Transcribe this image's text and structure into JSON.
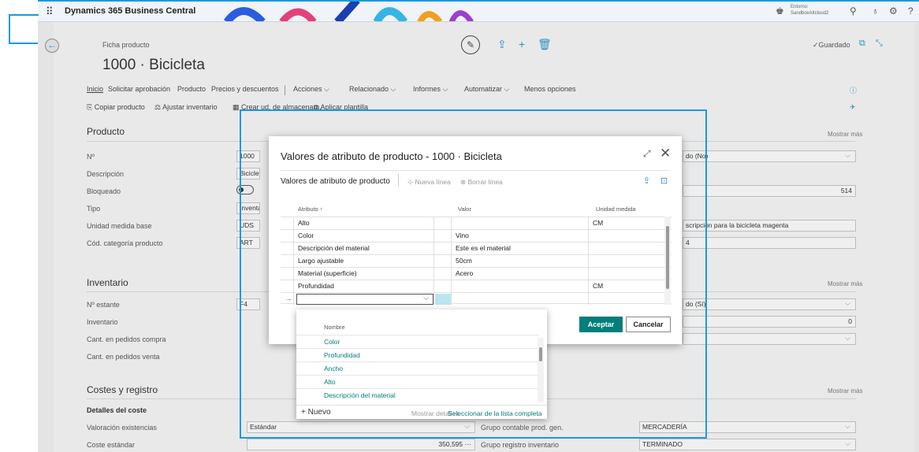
{
  "app": {
    "waffle_icon": "waffle-icon",
    "title": "Dynamics 365 Business Central",
    "environment_line1": "Entorno:",
    "environment_line2": "SandboxAltcloud2",
    "accent_color": "#1a9ae0"
  },
  "page": {
    "breadcrumb": "Ficha producto",
    "title": "1000 · Bicicleta",
    "saved_status": "Guardado",
    "menu": [
      "Inicio",
      "Solicitar aprobación",
      "Producto",
      "Precios y descuentos",
      "Acciones",
      "Relacionado",
      "Informes",
      "Automatizar",
      "Menos opciones"
    ],
    "actions": [
      "Copiar producto",
      "Ajustar inventario",
      "Crear ud. de almacenam.",
      "Aplicar plantilla"
    ],
    "show_more": "Mostrar más",
    "sections": {
      "producto": "Producto",
      "inventario": "Inventario",
      "costes": "Costes y registro",
      "cost_details": "Detalles del coste"
    },
    "fields": {
      "no_label": "Nº",
      "no_value": "1000",
      "descripcion_label": "Descripción",
      "descripcion_value": "Biciclet",
      "bloqueado_label": "Bloqueado",
      "tipo_label": "Tipo",
      "tipo_value": "Inventa",
      "unidad_label": "Unidad medida base",
      "unidad_value": "UDS",
      "categoria_label": "Cód. categoría producto",
      "categoria_value": "ART",
      "right_no_value": "do (No)",
      "right_count_value": "514",
      "right_desc_value": "scripción para la bicicleta magenta",
      "right_four_value": "4",
      "estante_label": "Nº estante",
      "estante_value": "F4",
      "inventario_label": "Inventario",
      "inventario_value": "0",
      "right_inv_value": "do (Sí)",
      "compra_label": "Cant. en pedidos compra",
      "venta_label": "Cant. en pedidos venta",
      "valoracion_label": "Valoración existencias",
      "valoracion_value": "Estándar",
      "coste_label": "Coste estándar",
      "coste_value": "350,595",
      "grupo_prod_label": "Grupo contable prod. gen.",
      "grupo_prod_value": "MERCADERÍA",
      "grupo_inv_label": "Grupo registro inventario",
      "grupo_inv_value": "TERMINADO"
    }
  },
  "modal": {
    "title": "Valores de atributo de producto - 1000 · Bicicleta",
    "subtitle": "Valores de atributo de producto",
    "new_line": "Nueva línea",
    "delete_line": "Borrar línea",
    "columns": [
      "Atributo ↑",
      "Valor",
      "Unidad medida"
    ],
    "rows": [
      {
        "attr": "Alto",
        "value": "",
        "unit": "CM"
      },
      {
        "attr": "Color",
        "value": "Vino",
        "unit": ""
      },
      {
        "attr": "Descripción del material",
        "value": "Este es el material",
        "unit": ""
      },
      {
        "attr": "Largo ajustable",
        "value": "50cm",
        "unit": ""
      },
      {
        "attr": "Material (superficie)",
        "value": "Acero",
        "unit": ""
      },
      {
        "attr": "Profundidad",
        "value": "",
        "unit": "CM"
      }
    ],
    "accept": "Aceptar",
    "cancel": "Cancelar"
  },
  "dropdown": {
    "header": "Nombre",
    "items": [
      "Color",
      "Profundidad",
      "Ancho",
      "Alto",
      "Descripción del material"
    ],
    "new": "+ Nuevo",
    "show_details": "Mostrar detalles",
    "select_full": "Seleccionar de la lista completa"
  }
}
